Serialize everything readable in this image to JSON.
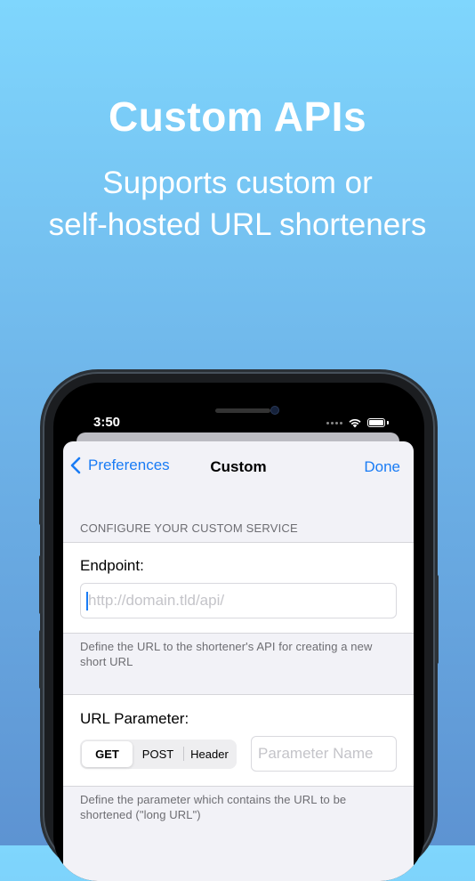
{
  "headline": "Custom APIs",
  "subline": [
    "Supports custom or",
    "self-hosted URL shorteners"
  ],
  "status_bar": {
    "time": "3:50"
  },
  "nav": {
    "back_label": "Preferences",
    "title": "Custom",
    "done_label": "Done"
  },
  "section": {
    "header": "CONFIGURE YOUR CUSTOM SERVICE"
  },
  "endpoint": {
    "label": "Endpoint:",
    "placeholder": "http://domain.tld/api/",
    "footer": "Define the URL to the shortener's API for creating a new short URL"
  },
  "url_parameter": {
    "label": "URL Parameter:",
    "methods": [
      "GET",
      "POST",
      "Header"
    ],
    "selected": "GET",
    "placeholder": "Parameter Name",
    "footer": "Define the parameter which contains the URL to be shortened (\"long URL\")"
  },
  "colors": {
    "accent": "#1a7cf5",
    "background_top": "#7fd6fd",
    "background_bottom": "#5d93d2"
  }
}
